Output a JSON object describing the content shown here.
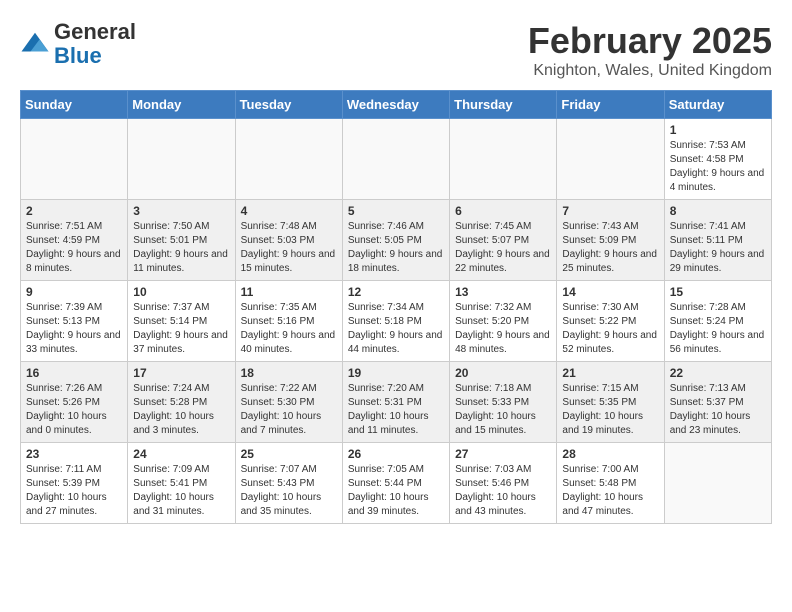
{
  "logo": {
    "general": "General",
    "blue": "Blue"
  },
  "title": "February 2025",
  "subtitle": "Knighton, Wales, United Kingdom",
  "days_of_week": [
    "Sunday",
    "Monday",
    "Tuesday",
    "Wednesday",
    "Thursday",
    "Friday",
    "Saturday"
  ],
  "weeks": [
    {
      "shaded": false,
      "days": [
        {
          "empty": true
        },
        {
          "empty": true
        },
        {
          "empty": true
        },
        {
          "empty": true
        },
        {
          "empty": true
        },
        {
          "empty": true
        },
        {
          "num": "1",
          "sunrise": "Sunrise: 7:53 AM",
          "sunset": "Sunset: 4:58 PM",
          "daylight": "Daylight: 9 hours and 4 minutes."
        }
      ]
    },
    {
      "shaded": true,
      "days": [
        {
          "num": "2",
          "sunrise": "Sunrise: 7:51 AM",
          "sunset": "Sunset: 4:59 PM",
          "daylight": "Daylight: 9 hours and 8 minutes."
        },
        {
          "num": "3",
          "sunrise": "Sunrise: 7:50 AM",
          "sunset": "Sunset: 5:01 PM",
          "daylight": "Daylight: 9 hours and 11 minutes."
        },
        {
          "num": "4",
          "sunrise": "Sunrise: 7:48 AM",
          "sunset": "Sunset: 5:03 PM",
          "daylight": "Daylight: 9 hours and 15 minutes."
        },
        {
          "num": "5",
          "sunrise": "Sunrise: 7:46 AM",
          "sunset": "Sunset: 5:05 PM",
          "daylight": "Daylight: 9 hours and 18 minutes."
        },
        {
          "num": "6",
          "sunrise": "Sunrise: 7:45 AM",
          "sunset": "Sunset: 5:07 PM",
          "daylight": "Daylight: 9 hours and 22 minutes."
        },
        {
          "num": "7",
          "sunrise": "Sunrise: 7:43 AM",
          "sunset": "Sunset: 5:09 PM",
          "daylight": "Daylight: 9 hours and 25 minutes."
        },
        {
          "num": "8",
          "sunrise": "Sunrise: 7:41 AM",
          "sunset": "Sunset: 5:11 PM",
          "daylight": "Daylight: 9 hours and 29 minutes."
        }
      ]
    },
    {
      "shaded": false,
      "days": [
        {
          "num": "9",
          "sunrise": "Sunrise: 7:39 AM",
          "sunset": "Sunset: 5:13 PM",
          "daylight": "Daylight: 9 hours and 33 minutes."
        },
        {
          "num": "10",
          "sunrise": "Sunrise: 7:37 AM",
          "sunset": "Sunset: 5:14 PM",
          "daylight": "Daylight: 9 hours and 37 minutes."
        },
        {
          "num": "11",
          "sunrise": "Sunrise: 7:35 AM",
          "sunset": "Sunset: 5:16 PM",
          "daylight": "Daylight: 9 hours and 40 minutes."
        },
        {
          "num": "12",
          "sunrise": "Sunrise: 7:34 AM",
          "sunset": "Sunset: 5:18 PM",
          "daylight": "Daylight: 9 hours and 44 minutes."
        },
        {
          "num": "13",
          "sunrise": "Sunrise: 7:32 AM",
          "sunset": "Sunset: 5:20 PM",
          "daylight": "Daylight: 9 hours and 48 minutes."
        },
        {
          "num": "14",
          "sunrise": "Sunrise: 7:30 AM",
          "sunset": "Sunset: 5:22 PM",
          "daylight": "Daylight: 9 hours and 52 minutes."
        },
        {
          "num": "15",
          "sunrise": "Sunrise: 7:28 AM",
          "sunset": "Sunset: 5:24 PM",
          "daylight": "Daylight: 9 hours and 56 minutes."
        }
      ]
    },
    {
      "shaded": true,
      "days": [
        {
          "num": "16",
          "sunrise": "Sunrise: 7:26 AM",
          "sunset": "Sunset: 5:26 PM",
          "daylight": "Daylight: 10 hours and 0 minutes."
        },
        {
          "num": "17",
          "sunrise": "Sunrise: 7:24 AM",
          "sunset": "Sunset: 5:28 PM",
          "daylight": "Daylight: 10 hours and 3 minutes."
        },
        {
          "num": "18",
          "sunrise": "Sunrise: 7:22 AM",
          "sunset": "Sunset: 5:30 PM",
          "daylight": "Daylight: 10 hours and 7 minutes."
        },
        {
          "num": "19",
          "sunrise": "Sunrise: 7:20 AM",
          "sunset": "Sunset: 5:31 PM",
          "daylight": "Daylight: 10 hours and 11 minutes."
        },
        {
          "num": "20",
          "sunrise": "Sunrise: 7:18 AM",
          "sunset": "Sunset: 5:33 PM",
          "daylight": "Daylight: 10 hours and 15 minutes."
        },
        {
          "num": "21",
          "sunrise": "Sunrise: 7:15 AM",
          "sunset": "Sunset: 5:35 PM",
          "daylight": "Daylight: 10 hours and 19 minutes."
        },
        {
          "num": "22",
          "sunrise": "Sunrise: 7:13 AM",
          "sunset": "Sunset: 5:37 PM",
          "daylight": "Daylight: 10 hours and 23 minutes."
        }
      ]
    },
    {
      "shaded": false,
      "days": [
        {
          "num": "23",
          "sunrise": "Sunrise: 7:11 AM",
          "sunset": "Sunset: 5:39 PM",
          "daylight": "Daylight: 10 hours and 27 minutes."
        },
        {
          "num": "24",
          "sunrise": "Sunrise: 7:09 AM",
          "sunset": "Sunset: 5:41 PM",
          "daylight": "Daylight: 10 hours and 31 minutes."
        },
        {
          "num": "25",
          "sunrise": "Sunrise: 7:07 AM",
          "sunset": "Sunset: 5:43 PM",
          "daylight": "Daylight: 10 hours and 35 minutes."
        },
        {
          "num": "26",
          "sunrise": "Sunrise: 7:05 AM",
          "sunset": "Sunset: 5:44 PM",
          "daylight": "Daylight: 10 hours and 39 minutes."
        },
        {
          "num": "27",
          "sunrise": "Sunrise: 7:03 AM",
          "sunset": "Sunset: 5:46 PM",
          "daylight": "Daylight: 10 hours and 43 minutes."
        },
        {
          "num": "28",
          "sunrise": "Sunrise: 7:00 AM",
          "sunset": "Sunset: 5:48 PM",
          "daylight": "Daylight: 10 hours and 47 minutes."
        },
        {
          "empty": true
        }
      ]
    }
  ]
}
